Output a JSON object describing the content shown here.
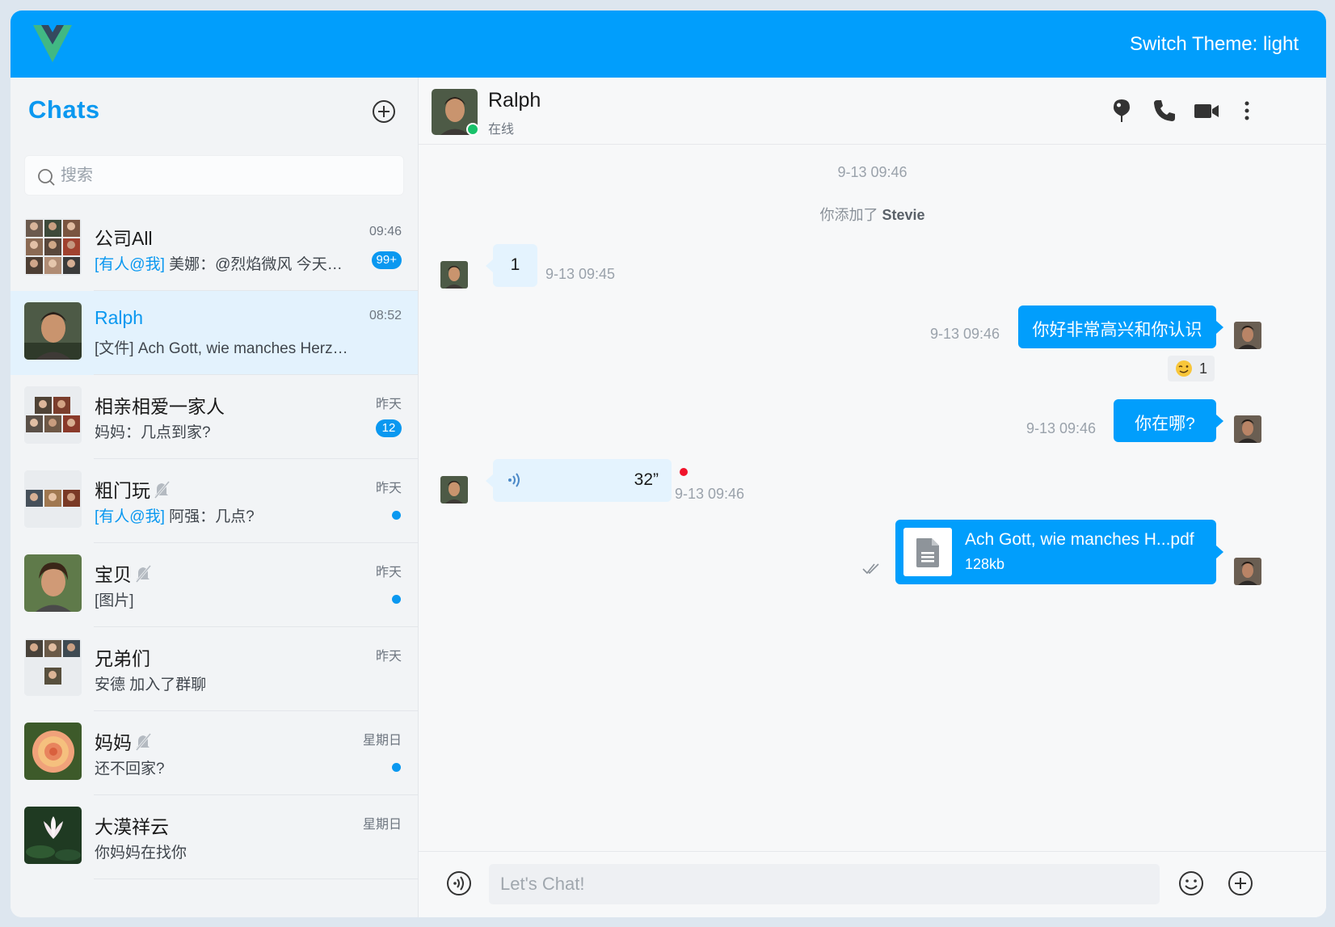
{
  "app": {
    "theme_label": "Switch Theme: light"
  },
  "sidebar": {
    "title": "Chats",
    "search_placeholder": "搜索",
    "chats": [
      {
        "name": "公司All",
        "time": "09:46",
        "mention": "[有人@我]",
        "preview": "美娜：@烈焰微风 今天中午一起吃饭吗",
        "badge": "99+"
      },
      {
        "name": "Ralph",
        "time": "08:52",
        "preview": "[文件] Ach Gott, wie manches Herzeleid.pdf"
      },
      {
        "name": "相亲相爱一家人",
        "time": "昨天",
        "preview": "妈妈：几点到家?",
        "badge": "12"
      },
      {
        "name": "粗门玩",
        "time": "昨天",
        "mention": "[有人@我]",
        "preview": "阿强：几点?"
      },
      {
        "name": "宝贝",
        "time": "昨天",
        "preview": "[图片]"
      },
      {
        "name": "兄弟们",
        "time": "昨天",
        "preview": "安德 加入了群聊"
      },
      {
        "name": "妈妈",
        "time": "星期日",
        "preview": "还不回家?"
      },
      {
        "name": "大漠祥云",
        "time": "星期日",
        "preview": "你妈妈在找你"
      }
    ]
  },
  "conversation": {
    "name": "Ralph",
    "status": "在线",
    "time_divider": "9-13 09:46",
    "system_prefix": "你添加了",
    "system_user": "Stevie",
    "messages": [
      {
        "text": "1",
        "time": "9-13 09:45"
      },
      {
        "text": "你好非常高兴和你认识",
        "time": "9-13 09:46",
        "reaction_count": "1"
      },
      {
        "text": "你在哪?",
        "time": "9-13 09:46"
      },
      {
        "duration": "32”",
        "time": "9-13 09:46"
      },
      {
        "file_name": "Ach Gott, wie manches H...pdf",
        "file_size": "128kb"
      }
    ],
    "input_placeholder": "Let's Chat!"
  },
  "colors": {
    "brand": "#019efc",
    "accent": "#0a98f0",
    "online": "#18c26a",
    "unread": "#f0142b"
  },
  "icons": [
    "vue-logo-icon",
    "add-circle-icon",
    "search-icon",
    "muted-bell-icon",
    "location-pin-icon",
    "phone-icon",
    "video-camera-icon",
    "more-vertical-icon",
    "wink-emoji-icon",
    "voice-wave-icon",
    "file-document-icon",
    "double-check-icon",
    "voice-input-icon",
    "emoji-icon"
  ]
}
